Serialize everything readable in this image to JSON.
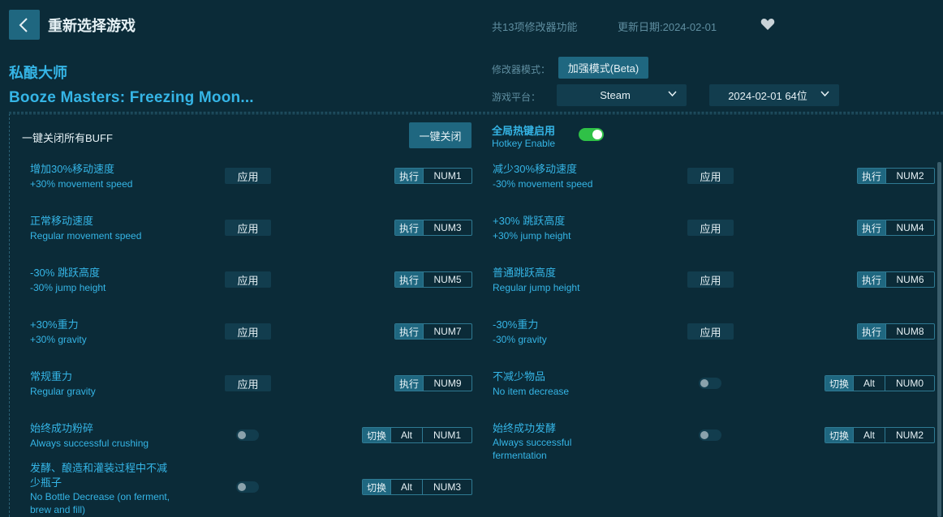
{
  "header": {
    "title": "重新选择游戏",
    "feature_count": "共13项修改器功能",
    "update_date": "更新日期:2024-02-01"
  },
  "game": {
    "name_cn": "私酿大师",
    "name_en": "Booze Masters: Freezing Moon..."
  },
  "settings": {
    "mode_label": "修改器模式：",
    "mode_value": "加强模式(Beta)",
    "platform_label": "游戏平台：",
    "platform_value": "Steam",
    "version_value": "2024-02-01 64位"
  },
  "panel": {
    "all_buff_label": "一键关闭所有BUFF",
    "close_all_label": "一键关闭",
    "hotkey_cn": "全局热键启用",
    "hotkey_en": "Hotkey Enable",
    "hotkey_enabled": true
  },
  "labels": {
    "apply": "应用",
    "execute": "执行",
    "toggle": "切换",
    "alt": "Alt"
  },
  "features": [
    {
      "cn": "增加30%移动速度",
      "en": "+30% movement speed",
      "type": "apply",
      "key": "NUM1"
    },
    {
      "cn": "减少30%移动速度",
      "en": "-30% movement speed",
      "type": "apply",
      "key": "NUM2"
    },
    {
      "cn": "正常移动速度",
      "en": "Regular movement speed",
      "type": "apply",
      "key": "NUM3"
    },
    {
      "cn": "+30% 跳跃高度",
      "en": "+30% jump height",
      "type": "apply",
      "key": "NUM4"
    },
    {
      "cn": "-30% 跳跃高度",
      "en": "-30% jump height",
      "type": "apply",
      "key": "NUM5"
    },
    {
      "cn": "普通跳跃高度",
      "en": "Regular jump height",
      "type": "apply",
      "key": "NUM6"
    },
    {
      "cn": "+30%重力",
      "en": "+30% gravity",
      "type": "apply",
      "key": "NUM7"
    },
    {
      "cn": "-30%重力",
      "en": "-30% gravity",
      "type": "apply",
      "key": "NUM8"
    },
    {
      "cn": "常规重力",
      "en": "Regular gravity",
      "type": "apply",
      "key": "NUM9"
    },
    {
      "cn": "不减少物品",
      "en": "No item decrease",
      "type": "toggle",
      "key": "NUM0",
      "on": false
    },
    {
      "cn": "始终成功粉碎",
      "en": "Always successful crushing",
      "type": "toggle",
      "key": "NUM1",
      "on": false
    },
    {
      "cn": "始终成功发酵",
      "en": "Always successful fermentation",
      "type": "toggle",
      "key": "NUM2",
      "on": false
    },
    {
      "cn": "发酵、酿造和灌装过程中不减少瓶子",
      "en": "No Bottle Decrease (on ferment, brew and fill)",
      "type": "toggle",
      "key": "NUM3",
      "on": false
    }
  ]
}
